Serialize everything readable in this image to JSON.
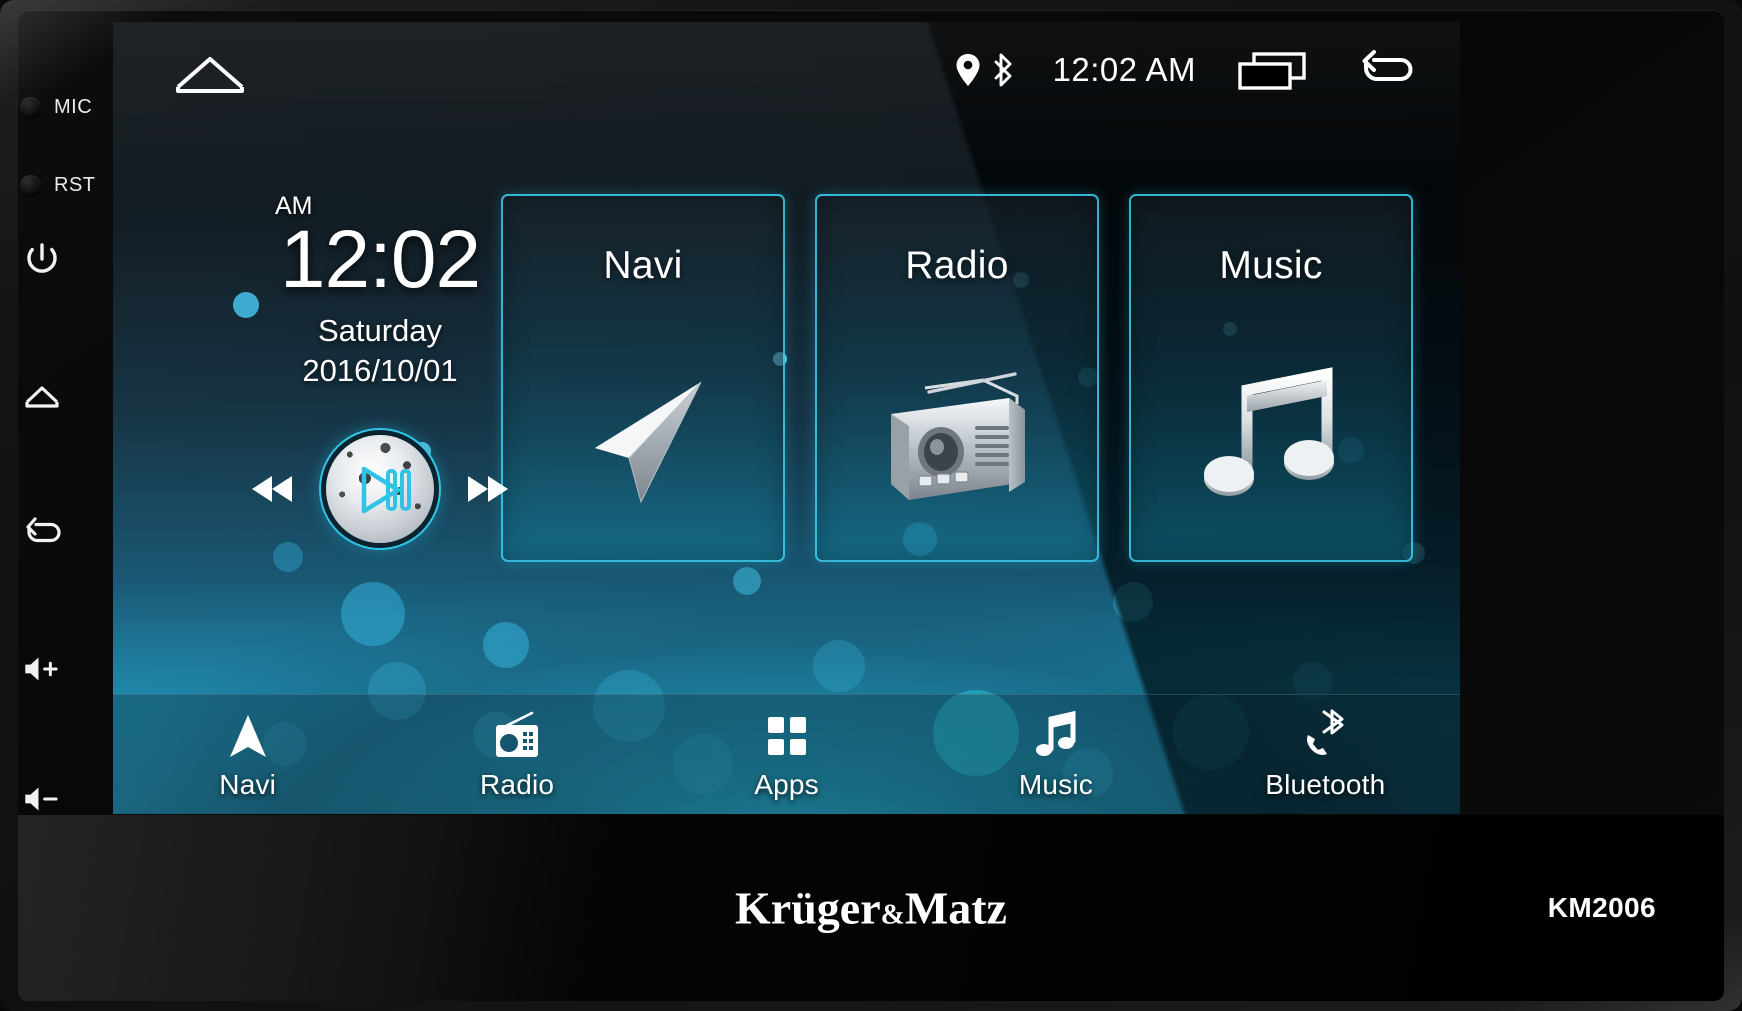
{
  "device": {
    "brand": "Krüger",
    "brand_amp": "&",
    "brand_second": "Matz",
    "model": "KM2006"
  },
  "hardware_rail": {
    "buttons": [
      {
        "label": "MIC",
        "icon": "mic-dot-icon",
        "type": "dot"
      },
      {
        "label": "RST",
        "icon": "reset-dot-icon",
        "type": "dot"
      },
      {
        "label": "",
        "icon": "power-icon",
        "type": "icon"
      },
      {
        "label": "",
        "icon": "home-icon",
        "type": "icon"
      },
      {
        "label": "",
        "icon": "back-icon",
        "type": "icon"
      },
      {
        "label": "",
        "icon": "volume-up-icon",
        "type": "icon"
      },
      {
        "label": "",
        "icon": "volume-down-icon",
        "type": "icon"
      }
    ]
  },
  "statusbar": {
    "home_icon": "home-outline-icon",
    "location_icon": "location-pin-icon",
    "bluetooth_icon": "bluetooth-icon",
    "clock": "12:02 AM",
    "recents_icon": "recent-apps-icon",
    "back_icon": "back-arrow-icon"
  },
  "clock_widget": {
    "meridiem": "AM",
    "time": "12:02",
    "weekday": "Saturday",
    "date": "2016/10/01"
  },
  "media_controls": {
    "previous_icon": "rewind-icon",
    "play_icon": "play-pause-disc-icon",
    "next_icon": "fast-forward-icon"
  },
  "tiles": [
    {
      "label": "Navi",
      "icon": "navigation-arrow-icon"
    },
    {
      "label": "Radio",
      "icon": "radio-receiver-icon"
    },
    {
      "label": "Music",
      "icon": "music-note-icon"
    }
  ],
  "dock": {
    "items": [
      {
        "label": "Navi",
        "icon": "navigation-arrow-icon"
      },
      {
        "label": "Radio",
        "icon": "radio-icon"
      },
      {
        "label": "Apps",
        "icon": "apps-grid-icon"
      },
      {
        "label": "Music",
        "icon": "music-note-icon"
      },
      {
        "label": "Bluetooth",
        "icon": "bluetooth-phone-icon"
      }
    ]
  },
  "colors": {
    "accent_cyan": "#3ccdee",
    "tile_border": "#3ccdee",
    "text_primary": "#ffffff",
    "chassis": "#141414",
    "wallpaper_teal": "#1ea4c8"
  }
}
